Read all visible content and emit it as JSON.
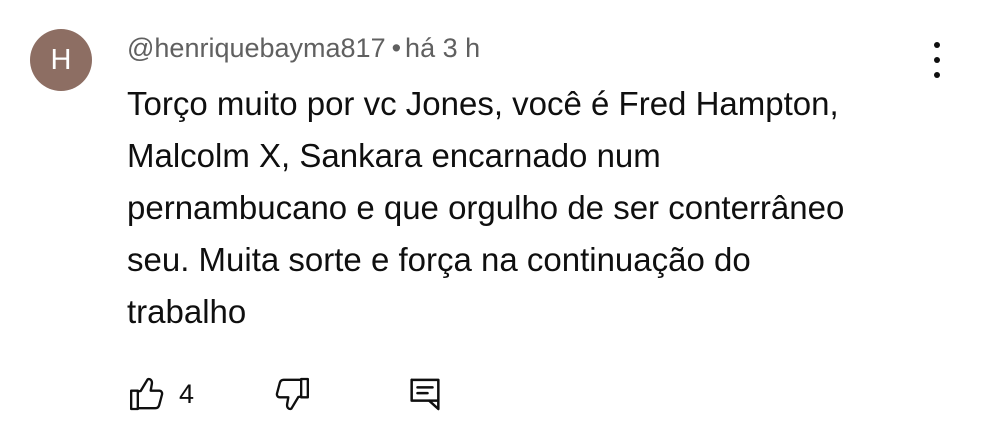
{
  "comment": {
    "avatar_letter": "H",
    "avatar_color": "#8d6e63",
    "author": "@henriquebayma817",
    "separator": "•",
    "time": "há 3 h",
    "text_lines": [
      "Torço muito por vc Jones, você é Fred Hampton,",
      "Malcolm X, Sankara encarnado num",
      "pernambucano e que orgulho de ser conterrâneo",
      "seu. Muita sorte e força na continuação do",
      "trabalho"
    ],
    "likes": "4",
    "icons": {
      "more": "more-vertical-icon",
      "like": "thumbs-up-icon",
      "dislike": "thumbs-down-icon",
      "reply": "reply-comment-icon"
    }
  }
}
